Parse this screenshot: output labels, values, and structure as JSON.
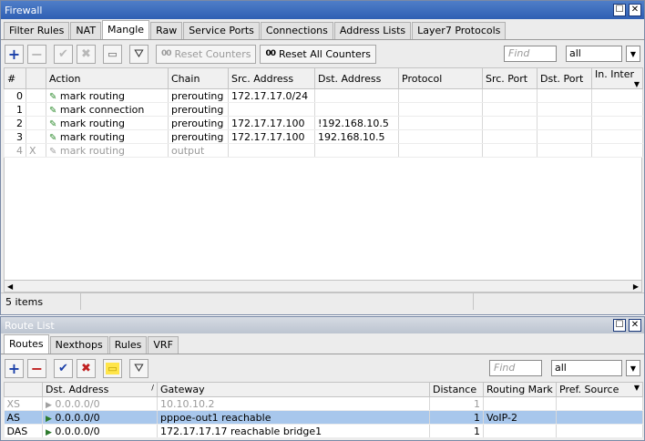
{
  "firewall": {
    "title": "Firewall",
    "tabs": [
      "Filter Rules",
      "NAT",
      "Mangle",
      "Raw",
      "Service Ports",
      "Connections",
      "Address Lists",
      "Layer7 Protocols"
    ],
    "active_tab": "Mangle",
    "toolbar": {
      "reset_counters": "Reset Counters",
      "reset_all_counters": "Reset All Counters",
      "counter_icon": "00",
      "find_placeholder": "Find",
      "filter_value": "all"
    },
    "columns": [
      "#",
      "",
      "Action",
      "Chain",
      "Src. Address",
      "Dst. Address",
      "Protocol",
      "Src. Port",
      "Dst. Port",
      "In. Inter"
    ],
    "rows": [
      {
        "num": "0",
        "flag": "",
        "action": "mark routing",
        "chain": "prerouting",
        "src": "172.17.17.0/24",
        "dst": "",
        "disabled": false
      },
      {
        "num": "1",
        "flag": "",
        "action": "mark connection",
        "chain": "prerouting",
        "src": "",
        "dst": "",
        "disabled": false
      },
      {
        "num": "2",
        "flag": "",
        "action": "mark routing",
        "chain": "prerouting",
        "src": "172.17.17.100",
        "dst": "!192.168.10.5",
        "disabled": false
      },
      {
        "num": "3",
        "flag": "",
        "action": "mark routing",
        "chain": "prerouting",
        "src": "172.17.17.100",
        "dst": "192.168.10.5",
        "disabled": false
      },
      {
        "num": "4",
        "flag": "X",
        "action": "mark routing",
        "chain": "output",
        "src": "",
        "dst": "",
        "disabled": true
      }
    ],
    "status": "5 items"
  },
  "routelist": {
    "title": "Route List",
    "tabs": [
      "Routes",
      "Nexthops",
      "Rules",
      "VRF"
    ],
    "active_tab": "Routes",
    "find_placeholder": "Find",
    "filter_value": "all",
    "columns": [
      "",
      "Dst. Address",
      "Gateway",
      "Distance",
      "Routing Mark",
      "Pref. Source"
    ],
    "rows": [
      {
        "flags": "XS",
        "dst": "0.0.0.0/0",
        "gateway": "10.10.10.2",
        "distance": "1",
        "mark": "",
        "pref": "",
        "disabled": true,
        "selected": false
      },
      {
        "flags": "AS",
        "dst": "0.0.0.0/0",
        "gateway": "pppoe-out1 reachable",
        "distance": "1",
        "mark": "VoIP-2",
        "pref": "",
        "disabled": false,
        "selected": true
      },
      {
        "flags": "DAS",
        "dst": "0.0.0.0/0",
        "gateway": "172.17.17.17 reachable bridge1",
        "distance": "1",
        "mark": "",
        "pref": "",
        "disabled": false,
        "selected": false
      }
    ]
  },
  "colors": {
    "titlebar": "#2f5fb3",
    "selected_row": "#a8c7ec",
    "add": "#1a3fa8",
    "remove": "#c02020"
  }
}
